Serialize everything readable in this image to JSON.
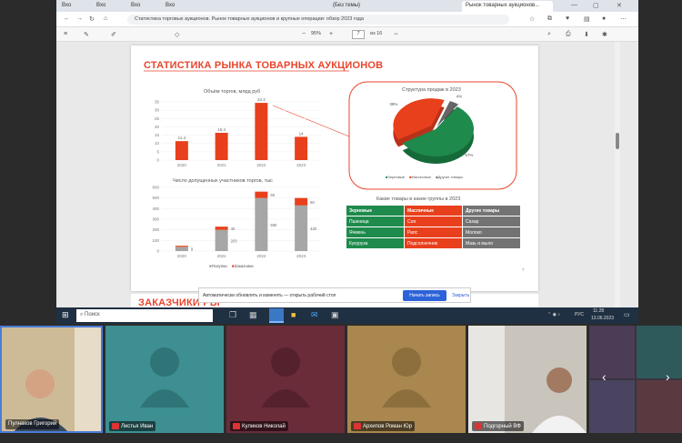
{
  "browser": {
    "tabs": [
      {
        "label": "Bxo"
      },
      {
        "label": "Bxo"
      },
      {
        "label": "Bxo"
      },
      {
        "label": "Bxo"
      },
      {
        "label": "(Без темы)"
      },
      {
        "label": "Рынок товарных аукционов..."
      }
    ],
    "url": "Статистика торговых аукционов. Рынок товарных аукционов и крупные операции: обзор 2023 года"
  },
  "pdf_toolbar": {
    "zoom": "95%",
    "page": "7",
    "page_total": "из 16"
  },
  "slide": {
    "title": "СТАТИСТИКА РЫНКА ТОВАРНЫХ АУКЦИОНОВ",
    "bottom_partial_title": "ЗАКАЗЧИКИ РЫ",
    "page_num": "7"
  },
  "chart_volume": {
    "title": "Объём торгов, млрд руб",
    "ticks": [
      "35",
      "30",
      "25",
      "20",
      "15",
      "10",
      "5",
      "0"
    ]
  },
  "chart_participants": {
    "title": "Число допущенных участников торгов, тыс",
    "ticks": [
      "600",
      "500",
      "400",
      "300",
      "200",
      "100",
      "0"
    ],
    "legend": [
      "Покупки",
      "Заказчики"
    ]
  },
  "chart_pie": {
    "title": "Структура продаж в 2023",
    "legend": [
      "Зерновые",
      "Масличные",
      "Другие товары"
    ]
  },
  "chart_data": [
    {
      "type": "bar",
      "title": "Объём торгов, млрд руб",
      "categories": [
        "2020",
        "2021",
        "2022",
        "2023"
      ],
      "values": [
        11.4,
        16.4,
        34.4,
        14
      ],
      "ylim": [
        0,
        35
      ]
    },
    {
      "type": "bar",
      "title": "Число допущенных участников торгов, тыс",
      "categories": [
        "2020",
        "2021",
        "2022",
        "2023"
      ],
      "series": [
        {
          "name": "Покупки",
          "values": [
            40,
            200,
            500,
            430
          ]
        },
        {
          "name": "Заказчики",
          "values": [
            10,
            30,
            60,
            70
          ]
        }
      ],
      "data_labels": [
        "9",
        "203",
        "500",
        "420"
      ],
      "top_labels": [
        "",
        "40",
        "60",
        "60"
      ],
      "ylim": [
        0,
        600
      ]
    },
    {
      "type": "pie",
      "title": "Структура продаж в 2023",
      "categories": [
        "Зерновые",
        "Масличные",
        "Другие товары"
      ],
      "values": [
        57,
        39,
        4
      ],
      "data_labels": [
        "57%",
        "39%",
        "4%"
      ]
    }
  ],
  "categories_table": {
    "title": "Какие товары в какие группы в 2023",
    "headers": [
      "Зерновые",
      "Масличные",
      "Другие товары"
    ],
    "rows": [
      [
        "Пшеница",
        "Соя",
        "Сахар"
      ],
      [
        "Ячмень",
        "Рапс",
        "Молоко"
      ],
      [
        "Кукуруза",
        "Подсолнечник",
        "Мазь и мыло"
      ]
    ]
  },
  "findbar": {
    "text": "Автоматически обновлять и изменять — открыть рабочий стол",
    "button": "Начать запись",
    "close": "Закрыть"
  },
  "taskbar": {
    "search": "Поиск",
    "lang": "РУС",
    "time": "11:28",
    "date": "13.06.2023"
  },
  "participants": [
    {
      "name": "Пулнаков Григорий"
    },
    {
      "name": "Листья Иван"
    },
    {
      "name": "Куликов Николай"
    },
    {
      "name": "Архипов Роман Юр"
    },
    {
      "name": "Подгорный ВФ"
    }
  ]
}
